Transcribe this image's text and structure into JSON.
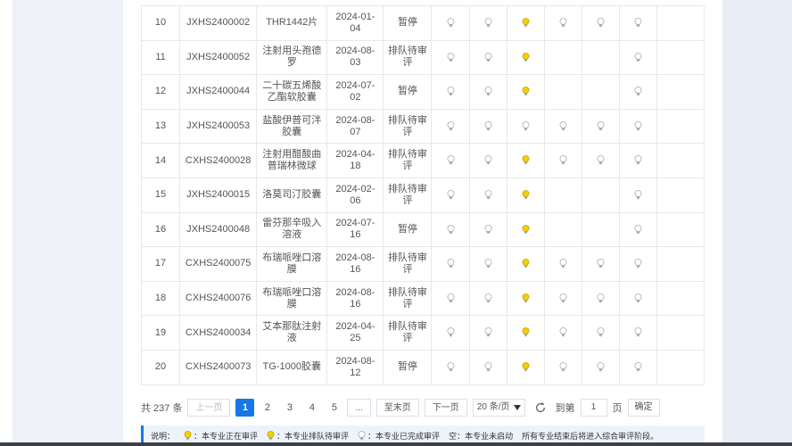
{
  "colors": {
    "on": "#f5d000",
    "off": "#c6c9cf",
    "accent": "#1677e5"
  },
  "table": {
    "rows": [
      {
        "no": "10",
        "code": "JXHS2400002",
        "name": "THR1442片",
        "date": "2024-01-04",
        "status": "暂停",
        "bulbs": [
          "off",
          "off",
          "on",
          "off",
          "off",
          "off"
        ]
      },
      {
        "no": "11",
        "code": "JXHS2400052",
        "name": "注射用头孢德罗",
        "date": "2024-08-03",
        "status": "排队待审评",
        "bulbs": [
          "off",
          "off",
          "on",
          "",
          "",
          "off"
        ]
      },
      {
        "no": "12",
        "code": "JXHS2400044",
        "name": "二十碳五烯酸乙酯软胶囊",
        "date": "2024-07-02",
        "status": "暂停",
        "bulbs": [
          "off",
          "off",
          "on",
          "",
          "",
          "off"
        ]
      },
      {
        "no": "13",
        "code": "JXHS2400053",
        "name": "盐酸伊普可泮胶囊",
        "date": "2024-08-07",
        "status": "排队待审评",
        "bulbs": [
          "off",
          "off",
          "off",
          "off",
          "off",
          "off"
        ]
      },
      {
        "no": "14",
        "code": "CXHS2400028",
        "name": "注射用醋酸曲普瑞林微球",
        "date": "2024-04-18",
        "status": "排队待审评",
        "bulbs": [
          "off",
          "off",
          "on",
          "off",
          "off",
          "off"
        ]
      },
      {
        "no": "15",
        "code": "JXHS2400015",
        "name": "洛莫司汀胶囊",
        "date": "2024-02-06",
        "status": "排队待审评",
        "bulbs": [
          "off",
          "off",
          "on",
          "",
          "",
          "off"
        ]
      },
      {
        "no": "16",
        "code": "JXHS2400048",
        "name": "雷芬那辛吸入溶液",
        "date": "2024-07-16",
        "status": "暂停",
        "bulbs": [
          "off",
          "off",
          "on",
          "",
          "",
          "off"
        ]
      },
      {
        "no": "17",
        "code": "CXHS2400075",
        "name": "布瑞哌唑口溶膜",
        "date": "2024-08-16",
        "status": "排队待审评",
        "bulbs": [
          "off",
          "off",
          "on",
          "off",
          "off",
          "off"
        ]
      },
      {
        "no": "18",
        "code": "CXHS2400076",
        "name": "布瑞哌唑口溶膜",
        "date": "2024-08-16",
        "status": "排队待审评",
        "bulbs": [
          "off",
          "off",
          "on",
          "off",
          "off",
          "off"
        ]
      },
      {
        "no": "19",
        "code": "CXHS2400034",
        "name": "艾本那肽注射液",
        "date": "2024-04-25",
        "status": "排队待审评",
        "bulbs": [
          "off",
          "off",
          "on",
          "off",
          "off",
          "off"
        ]
      },
      {
        "no": "20",
        "code": "CXHS2400073",
        "name": "TG-1000胶囊",
        "date": "2024-08-12",
        "status": "暂停",
        "bulbs": [
          "off",
          "off",
          "on",
          "off",
          "off",
          "off"
        ]
      }
    ]
  },
  "pagination": {
    "total": "共 237 条",
    "prev": "上一页",
    "pages": [
      "1",
      "2",
      "3",
      "4",
      "5"
    ],
    "ellipsis": "...",
    "last": "至末页",
    "next": "下一页",
    "page_size": "20 条/页",
    "goto_label": "到第",
    "page_value": "1",
    "page_unit": "页",
    "confirm": "确定"
  },
  "legend": {
    "title": "说明：",
    "items": [
      {
        "icon": "on",
        "text": "：本专业正在审评"
      },
      {
        "icon": "on",
        "text": "：本专业排队待审评"
      },
      {
        "icon": "off",
        "text": "：本专业已完成审评"
      }
    ],
    "empty_note": "空：本专业未启动",
    "final_note": "所有专业结束后将进入综合审评阶段。"
  }
}
